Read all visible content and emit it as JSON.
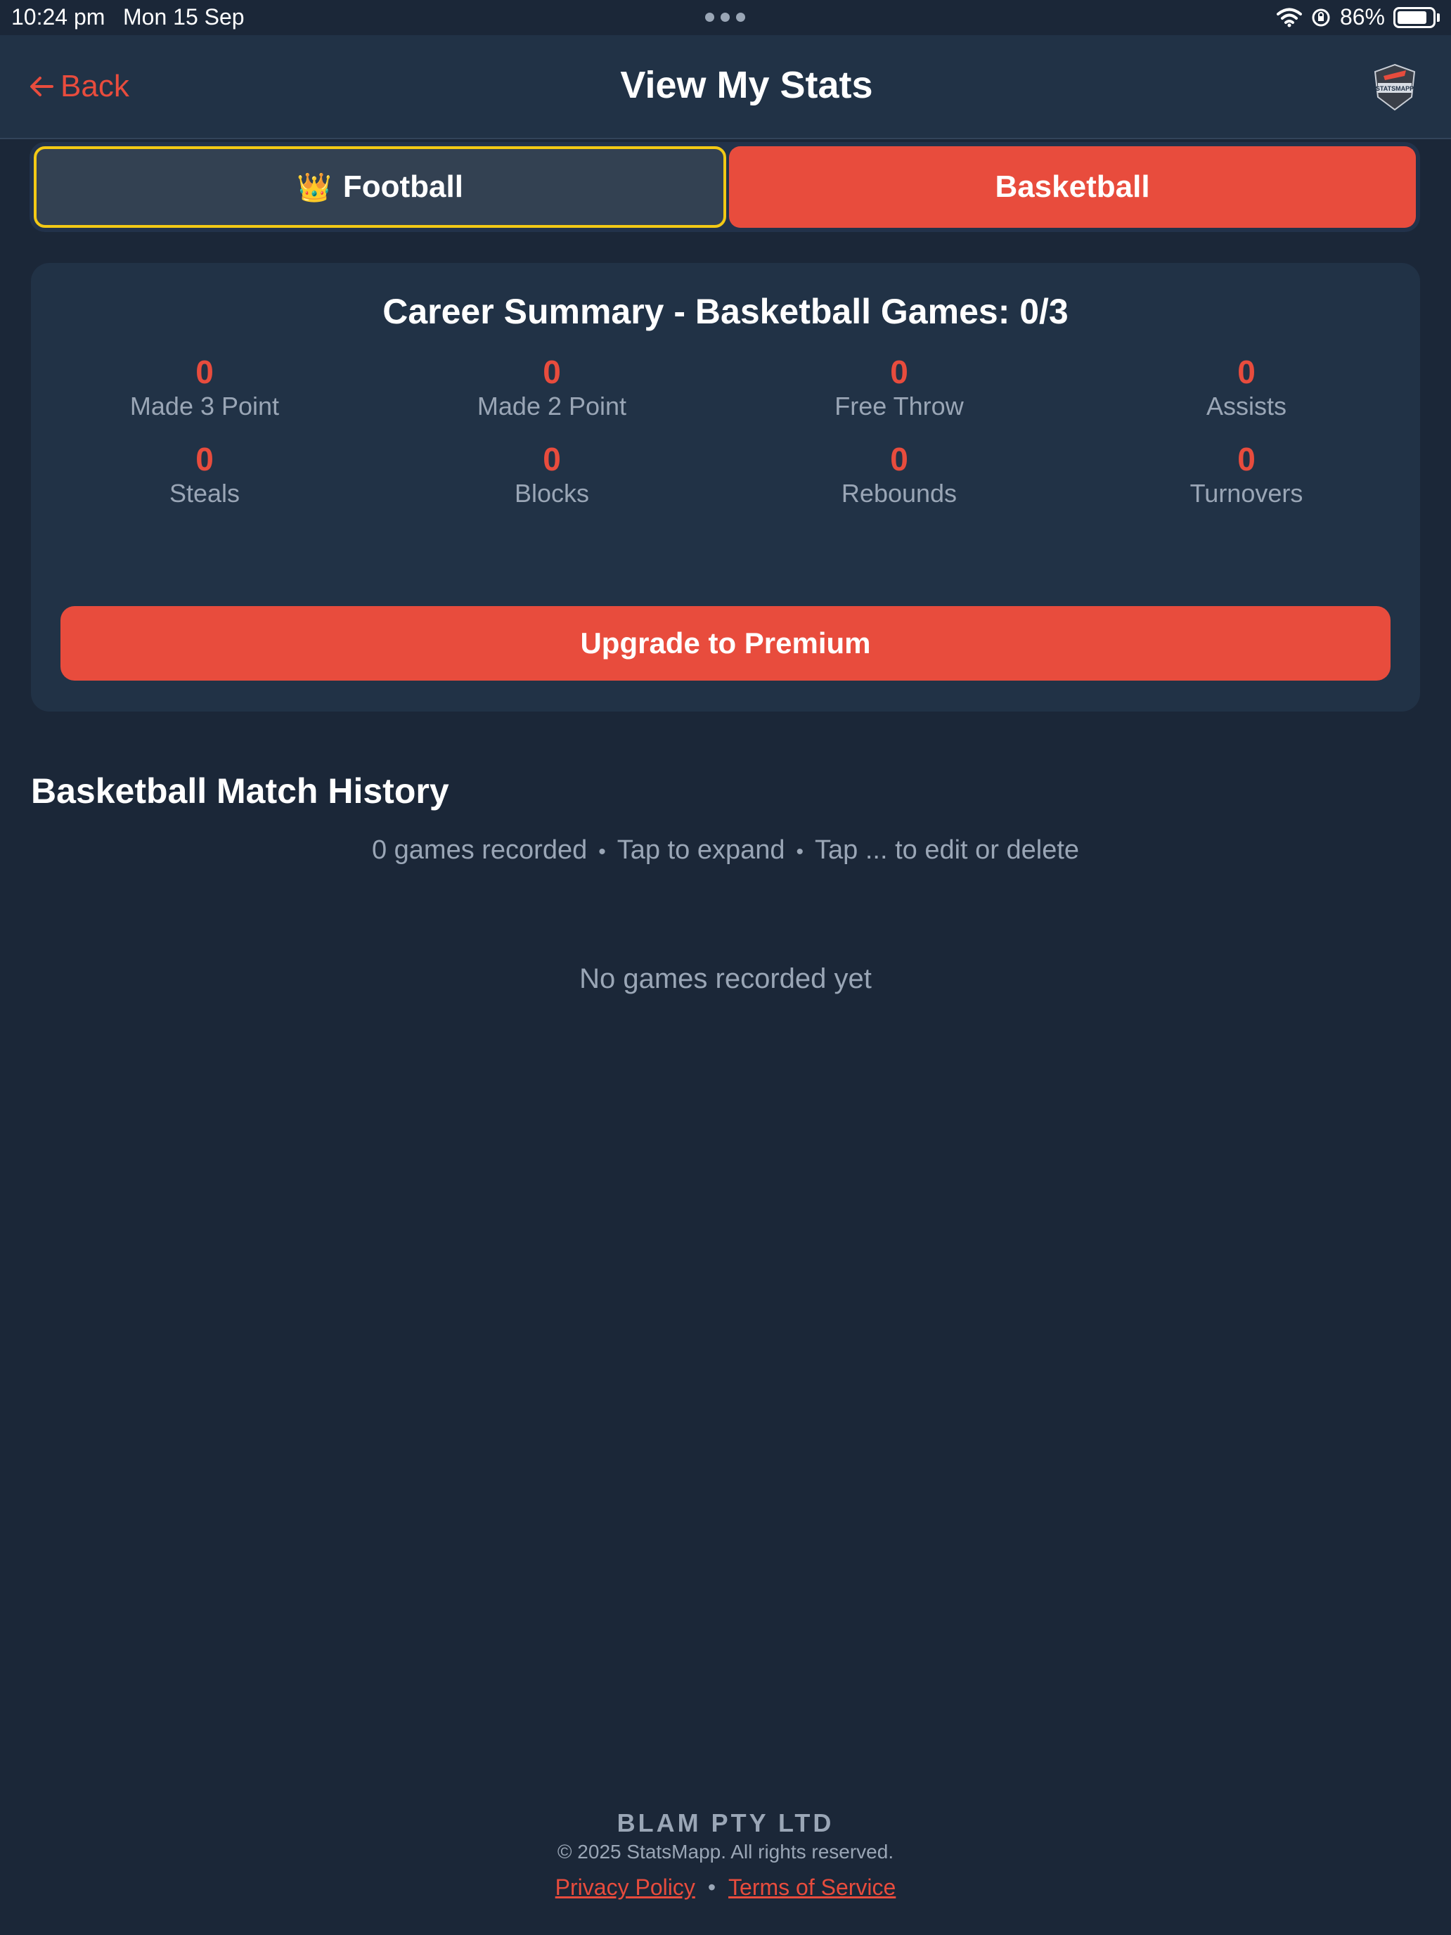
{
  "status_bar": {
    "time": "10:24 pm",
    "date": "Mon 15 Sep",
    "battery_percent": "86%",
    "battery_level": 0.86
  },
  "header": {
    "back_label": "Back",
    "title": "View My Stats",
    "logo_text": "STATSMAPP"
  },
  "tabs": [
    {
      "label": "Football",
      "icon": "👑",
      "icon_name": "crown-icon",
      "highlighted": true
    },
    {
      "label": "Basketball",
      "active": true
    }
  ],
  "summary": {
    "title": "Career Summary - Basketball Games: 0/3",
    "stats": [
      {
        "value": "0",
        "label": "Made 3 Point"
      },
      {
        "value": "0",
        "label": "Made 2 Point"
      },
      {
        "value": "0",
        "label": "Free Throw"
      },
      {
        "value": "0",
        "label": "Assists"
      },
      {
        "value": "0",
        "label": "Steals"
      },
      {
        "value": "0",
        "label": "Blocks"
      },
      {
        "value": "0",
        "label": "Rebounds"
      },
      {
        "value": "0",
        "label": "Turnovers"
      }
    ],
    "upgrade_label": "Upgrade to Premium"
  },
  "history": {
    "title": "Basketball Match History",
    "subtitle_parts": [
      "0 games recorded",
      "Tap to expand",
      "Tap ... to edit or delete"
    ],
    "separator": "•",
    "empty_message": "No games recorded yet"
  },
  "footer": {
    "company": "BLAM PTY LTD",
    "copyright": "© 2025 StatsMapp. All rights reserved.",
    "privacy_label": "Privacy Policy",
    "separator": "•",
    "terms_label": "Terms of Service"
  },
  "colors": {
    "background": "#1b2738",
    "card": "#213246",
    "accent": "#e84c3d",
    "highlight_border": "#f3c915",
    "muted_text": "#9aa6b6"
  }
}
